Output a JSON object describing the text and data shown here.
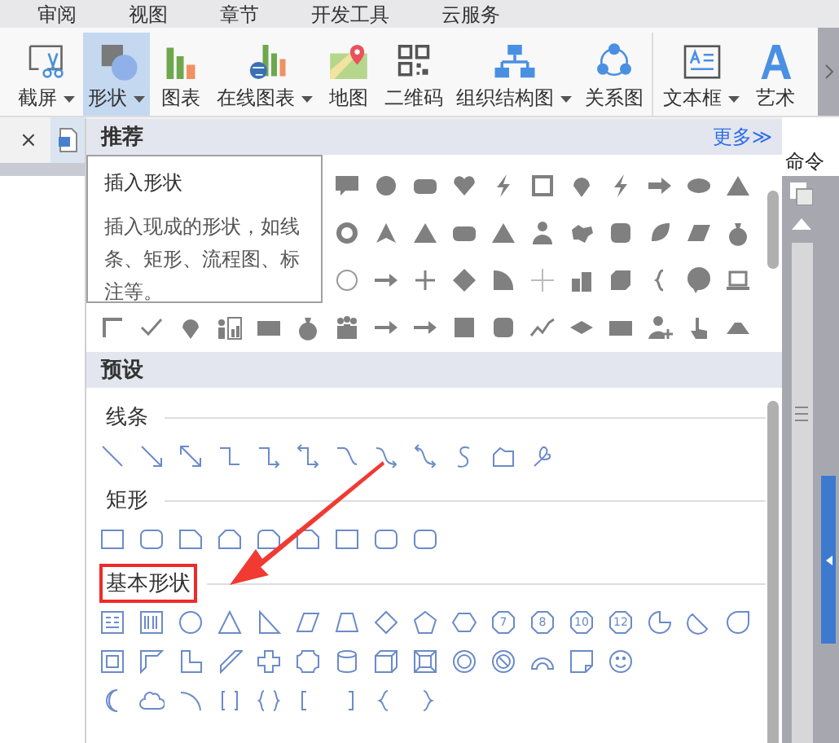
{
  "menu_tabs": [
    "审阅",
    "视图",
    "章节",
    "开发工具",
    "云服务"
  ],
  "ribbon": {
    "buttons": [
      {
        "kind": "screenshot",
        "label": "截屏",
        "dropdown": true,
        "selected": false
      },
      {
        "kind": "shapes",
        "label": "形状",
        "dropdown": true,
        "selected": true
      },
      {
        "kind": "chart",
        "label": "图表",
        "dropdown": false,
        "selected": false
      },
      {
        "kind": "online_chart",
        "label": "在线图表",
        "dropdown": true,
        "selected": false
      },
      {
        "kind": "map",
        "label": "地图",
        "dropdown": false,
        "selected": false
      },
      {
        "kind": "qrcode",
        "label": "二维码",
        "dropdown": false,
        "selected": false
      },
      {
        "kind": "org_chart",
        "label": "组织结构图",
        "dropdown": true,
        "selected": false
      },
      {
        "kind": "relation",
        "label": "关系图",
        "dropdown": false,
        "selected": false
      },
      {
        "kind": "textbox",
        "label": "文本框",
        "dropdown": true,
        "selected": false
      },
      {
        "kind": "art_text",
        "label": "艺术",
        "dropdown": false,
        "selected": false
      }
    ]
  },
  "doc_tabs": {
    "close": "×"
  },
  "side_panel": {
    "title": "命令"
  },
  "shapes_menu": {
    "recommended": {
      "title": "推荐",
      "more": "更多≫"
    },
    "presets": {
      "title": "预设",
      "groups": [
        {
          "title": "线条",
          "highlighted": false
        },
        {
          "title": "矩形",
          "highlighted": false
        },
        {
          "title": "基本形状",
          "highlighted": true,
          "numbered": [
            "7",
            "8",
            "10",
            "12"
          ]
        }
      ]
    }
  },
  "tooltip": {
    "title": "插入形状",
    "text": "插入现成的形状，如线条、矩形、流程图、标注等。"
  }
}
